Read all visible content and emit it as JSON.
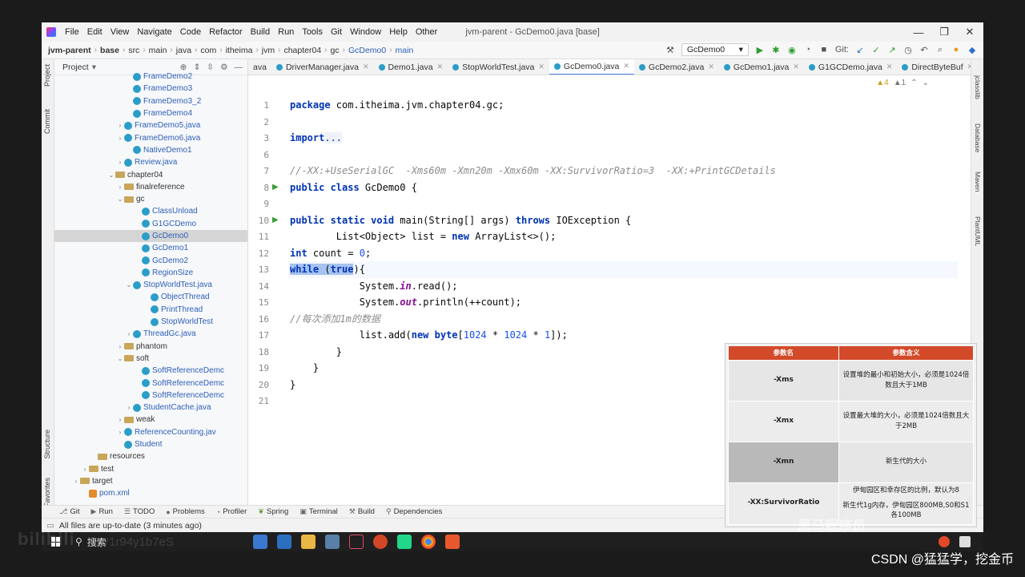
{
  "menubar": {
    "items": [
      "File",
      "Edit",
      "View",
      "Navigate",
      "Code",
      "Refactor",
      "Build",
      "Run",
      "Tools",
      "Git",
      "Window",
      "Help",
      "Other"
    ],
    "title": "jvm-parent - GcDemo0.java [base]",
    "controls": [
      "—",
      "❐",
      "✕"
    ]
  },
  "breadcrumb": [
    "jvm-parent",
    "base",
    "src",
    "main",
    "java",
    "com",
    "itheima",
    "jvm",
    "chapter04",
    "gc",
    "GcDemo0",
    "main"
  ],
  "toolbar": {
    "run_config": "GcDemo0",
    "git_label": "Git:"
  },
  "left_stripe": {
    "project": "Project",
    "commit": "Commit",
    "structure": "Structure",
    "favorites": "Favorites"
  },
  "project_panel": {
    "title": "Project",
    "tree": [
      {
        "label": "FrameDemo2",
        "indent": 8,
        "icon": "class",
        "arrow": ""
      },
      {
        "label": "FrameDemo3",
        "indent": 8,
        "icon": "class",
        "arrow": ""
      },
      {
        "label": "FrameDemo3_2",
        "indent": 8,
        "icon": "class",
        "arrow": ""
      },
      {
        "label": "FrameDemo4",
        "indent": 8,
        "icon": "class",
        "arrow": ""
      },
      {
        "label": "FrameDemo5.java",
        "indent": 7,
        "icon": "class",
        "arrow": "›"
      },
      {
        "label": "FrameDemo6.java",
        "indent": 7,
        "icon": "class",
        "arrow": "›"
      },
      {
        "label": "NativeDemo1",
        "indent": 8,
        "icon": "class",
        "arrow": ""
      },
      {
        "label": "Review.java",
        "indent": 7,
        "icon": "class",
        "arrow": "›"
      },
      {
        "label": "chapter04",
        "indent": 6,
        "icon": "folder",
        "arrow": "⌄"
      },
      {
        "label": "finalreference",
        "indent": 7,
        "icon": "folder",
        "arrow": "›"
      },
      {
        "label": "gc",
        "indent": 7,
        "icon": "folder",
        "arrow": "⌄"
      },
      {
        "label": "ClassUnload",
        "indent": 9,
        "icon": "class",
        "arrow": ""
      },
      {
        "label": "G1GCDemo",
        "indent": 9,
        "icon": "class",
        "arrow": ""
      },
      {
        "label": "GcDemo0",
        "indent": 9,
        "icon": "class",
        "arrow": "",
        "selected": true
      },
      {
        "label": "GcDemo1",
        "indent": 9,
        "icon": "class",
        "arrow": ""
      },
      {
        "label": "GcDemo2",
        "indent": 9,
        "icon": "class",
        "arrow": ""
      },
      {
        "label": "RegionSize",
        "indent": 9,
        "icon": "class",
        "arrow": ""
      },
      {
        "label": "StopWorldTest.java",
        "indent": 8,
        "icon": "class",
        "arrow": "⌄"
      },
      {
        "label": "ObjectThread",
        "indent": 10,
        "icon": "class",
        "arrow": ""
      },
      {
        "label": "PrintThread",
        "indent": 10,
        "icon": "class",
        "arrow": ""
      },
      {
        "label": "StopWorldTest",
        "indent": 10,
        "icon": "class",
        "arrow": ""
      },
      {
        "label": "ThreadGc.java",
        "indent": 8,
        "icon": "class",
        "arrow": "›"
      },
      {
        "label": "phantom",
        "indent": 7,
        "icon": "folder",
        "arrow": "›"
      },
      {
        "label": "soft",
        "indent": 7,
        "icon": "folder",
        "arrow": "⌄"
      },
      {
        "label": "SoftReferenceDemc",
        "indent": 9,
        "icon": "class",
        "arrow": ""
      },
      {
        "label": "SoftReferenceDemc",
        "indent": 9,
        "icon": "class",
        "arrow": ""
      },
      {
        "label": "SoftReferenceDemc",
        "indent": 9,
        "icon": "class",
        "arrow": ""
      },
      {
        "label": "StudentCache.java",
        "indent": 8,
        "icon": "class",
        "arrow": "›"
      },
      {
        "label": "weak",
        "indent": 7,
        "icon": "folder",
        "arrow": "›"
      },
      {
        "label": "ReferenceCounting.jav",
        "indent": 7,
        "icon": "class",
        "arrow": "›"
      },
      {
        "label": "Student",
        "indent": 7,
        "icon": "class",
        "arrow": ""
      },
      {
        "label": "resources",
        "indent": 4,
        "icon": "folder",
        "arrow": ""
      },
      {
        "label": "test",
        "indent": 3,
        "icon": "folder",
        "arrow": "›"
      },
      {
        "label": "target",
        "indent": 2,
        "icon": "folder",
        "arrow": "›"
      },
      {
        "label": "pom.xml",
        "indent": 3,
        "icon": "xml",
        "arrow": ""
      }
    ]
  },
  "editor_tabs": {
    "tabs": [
      "ava",
      "DriverManager.java",
      "Demo1.java",
      "StopWorldTest.java",
      "GcDemo0.java",
      "GcDemo2.java",
      "GcDemo1.java",
      "G1GCDemo.java",
      "DirectByteBuf"
    ],
    "active_index": 4
  },
  "inspections": {
    "warnings": "▲4",
    "weak": "▲1"
  },
  "code_lines": [
    {
      "n": "1",
      "html": "<span class=\"kw\">package</span> com.itheima.jvm.chapter04.gc;"
    },
    {
      "n": "2",
      "html": ""
    },
    {
      "n": "3",
      "html": "<span class=\"kw\">import</span> <span style=\"color:#0033b3;background:#eef2f8\">...</span>"
    },
    {
      "n": "6",
      "html": ""
    },
    {
      "n": "7",
      "html": "<span class=\"cm\">//-XX:+UseSerialGC  -Xms60m -Xmn20m -Xmx60m -XX:SurvivorRatio=3  -XX:+PrintGCDetails</span>"
    },
    {
      "n": "8",
      "html": "<span class=\"kw\">public class</span> GcDemo0 {",
      "run": true
    },
    {
      "n": "9",
      "html": ""
    },
    {
      "n": "10",
      "html": "    <span class=\"kw\">public static void</span> main(String[] args) <span class=\"kw\">throws</span> IOException {",
      "run": true
    },
    {
      "n": "11",
      "html": "        List&lt;Object&gt; list = <span class=\"kw\">new</span> ArrayList&lt;&gt;();"
    },
    {
      "n": "12",
      "html": "        <span class=\"kw\">int</span> count = <span class=\"num\">0</span>;"
    },
    {
      "n": "13",
      "html": "        <span class=\"sel\"><span class=\"kw\">while</span> (<span class=\"kw\">true</span></span>){",
      "hl": true
    },
    {
      "n": "14",
      "html": "            System.<i><b style=\"color:#871094\">in</b></i>.read();"
    },
    {
      "n": "15",
      "html": "            System.<i><b style=\"color:#871094\">out</b></i>.println(++count);"
    },
    {
      "n": "16",
      "html": "            <span class=\"cm\">//每次添加1m的数据</span>"
    },
    {
      "n": "17",
      "html": "            list.add(<span class=\"kw\">new byte</span>[<span class=\"num\">1024</span> * <span class=\"num\">1024</span> * <span class=\"num\">1</span>]);"
    },
    {
      "n": "18",
      "html": "        }"
    },
    {
      "n": "19",
      "html": "    }"
    },
    {
      "n": "20",
      "html": "}"
    },
    {
      "n": "21",
      "html": ""
    }
  ],
  "right_stripe": [
    "jclasslib",
    "Database",
    "Maven",
    "PlantUML"
  ],
  "bottom_tools": [
    "Git",
    "Run",
    "TODO",
    "Problems",
    "Profiler",
    "Spring",
    "Terminal",
    "Build",
    "Dependencies"
  ],
  "status": {
    "text": "All files are up-to-date (3 minutes ago)"
  },
  "param_table": {
    "headers": [
      "参数名",
      "参数含义"
    ],
    "rows": [
      {
        "name": "-Xms",
        "desc": "设置堆的最小和初始大小，必须是1024倍数且大于1MB"
      },
      {
        "name": "-Xmx",
        "desc": "设置最大堆的大小，必须是1024倍数且大于2MB"
      },
      {
        "name": "-Xmn",
        "desc": "新生代的大小"
      },
      {
        "name": "-XX:SurvivorRatio",
        "desc": "伊甸园区和幸存区的比例，默认为8",
        "desc2": "新生代1g内存，伊甸园区800MB,S0和S1各100MB"
      }
    ]
  },
  "taskbar": {
    "search": "搜索"
  },
  "watermarks": {
    "bili": "bilibili",
    "video_id": "BV1r94y1b7eS",
    "heima": "黑马程序员",
    "csdn": "CSDN @猛猛学，挖金币"
  }
}
